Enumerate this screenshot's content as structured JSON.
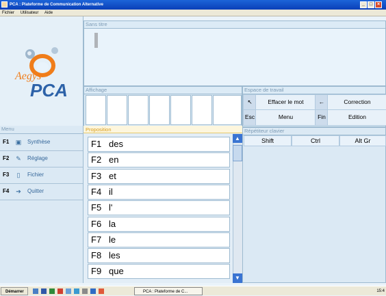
{
  "window": {
    "title": "PCA : Plateforme de Communication Alternative",
    "buttons": {
      "minimize": "_",
      "maximize": "□",
      "close": "×"
    }
  },
  "menubar": [
    "Fichier",
    "Utilisateur",
    "Aide"
  ],
  "logo": {
    "brand": "Aegys",
    "product": "PCA"
  },
  "document": {
    "title": "Sans titre"
  },
  "affichage": {
    "title": "Affichage"
  },
  "espace": {
    "title": "Espace de travail",
    "rows": [
      {
        "key": "↖",
        "label": "Effacer le mot",
        "key2": "←",
        "label2": "Correction"
      },
      {
        "key": "Esc",
        "label": "Menu",
        "key2": "Fin",
        "label2": "Edition"
      }
    ]
  },
  "menu": {
    "title": "Menu",
    "items": [
      {
        "key": "F1",
        "icon": "speaker-icon",
        "label": "Synthèse"
      },
      {
        "key": "F2",
        "icon": "wrench-icon",
        "label": "Réglage"
      },
      {
        "key": "F3",
        "icon": "file-icon",
        "label": "Fichier"
      },
      {
        "key": "F4",
        "icon": "exit-arrow-icon",
        "label": "Quitter"
      }
    ]
  },
  "proposition": {
    "title": "Proposition",
    "words": [
      {
        "key": "F1",
        "word": "des"
      },
      {
        "key": "F2",
        "word": "en"
      },
      {
        "key": "F3",
        "word": "et"
      },
      {
        "key": "F4",
        "word": "il"
      },
      {
        "key": "F5",
        "word": "l'"
      },
      {
        "key": "F6",
        "word": "la"
      },
      {
        "key": "F7",
        "word": "le"
      },
      {
        "key": "F8",
        "word": "les"
      },
      {
        "key": "F9",
        "word": "que"
      }
    ]
  },
  "repetiteur": {
    "title": "Répétiteur clavier",
    "keys": [
      "Shift",
      "Ctrl",
      "Alt Gr"
    ]
  },
  "taskbar": {
    "start": "Démarrer",
    "task": "PCA : Plateforme de C...",
    "clock": "15:4"
  },
  "colors": {
    "titlebar": "#0a3fb8",
    "accent": "#d79b1a",
    "logo_orange": "#f07d1a",
    "logo_blue": "#2d62a8"
  }
}
